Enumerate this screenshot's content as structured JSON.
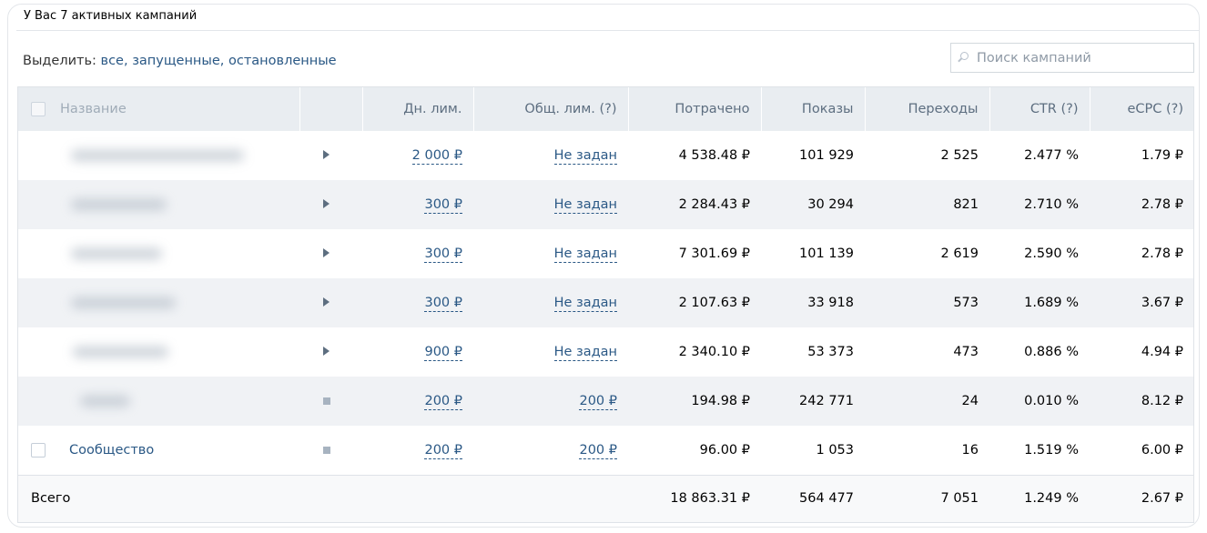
{
  "heading": "У Вас 7 активных кампаний",
  "filter": {
    "label": "Выделить:",
    "all": "все",
    "running": "запущенные",
    "stopped": "остановленные",
    "sep": ","
  },
  "search": {
    "placeholder": "Поиск кампаний"
  },
  "columns": {
    "name": "Название",
    "day_limit": "Дн. лим.",
    "total_limit": "Общ. лим. (?)",
    "spent": "Потрачено",
    "impressions": "Показы",
    "clicks": "Переходы",
    "ctr": "CTR (?)",
    "ecpc": "eCPC (?)"
  },
  "rows": [
    {
      "name": "",
      "status": "running",
      "day_limit": "2 000 ₽",
      "total_limit": "Не задан",
      "spent": "4 538.48 ₽",
      "impressions": "101 929",
      "clicks": "2 525",
      "ctr": "2.477 %",
      "ecpc": "1.79 ₽"
    },
    {
      "name": "",
      "status": "running",
      "day_limit": "300 ₽",
      "total_limit": "Не задан",
      "spent": "2 284.43 ₽",
      "impressions": "30 294",
      "clicks": "821",
      "ctr": "2.710 %",
      "ecpc": "2.78 ₽"
    },
    {
      "name": "",
      "status": "running",
      "day_limit": "300 ₽",
      "total_limit": "Не задан",
      "spent": "7 301.69 ₽",
      "impressions": "101 139",
      "clicks": "2 619",
      "ctr": "2.590 %",
      "ecpc": "2.78 ₽"
    },
    {
      "name": "",
      "status": "running",
      "day_limit": "300 ₽",
      "total_limit": "Не задан",
      "spent": "2 107.63 ₽",
      "impressions": "33 918",
      "clicks": "573",
      "ctr": "1.689 %",
      "ecpc": "3.67 ₽"
    },
    {
      "name": "",
      "status": "running",
      "day_limit": "900 ₽",
      "total_limit": "Не задан",
      "spent": "2 340.10 ₽",
      "impressions": "53 373",
      "clicks": "473",
      "ctr": "0.886 %",
      "ecpc": "4.94 ₽"
    },
    {
      "name": "",
      "status": "stopped",
      "day_limit": "200 ₽",
      "total_limit": "200 ₽",
      "spent": "194.98 ₽",
      "impressions": "242 771",
      "clicks": "24",
      "ctr": "0.010 %",
      "ecpc": "8.12 ₽"
    },
    {
      "name": "Сообщество",
      "status": "stopped",
      "day_limit": "200 ₽",
      "total_limit": "200 ₽",
      "spent": "96.00 ₽",
      "impressions": "1 053",
      "clicks": "16",
      "ctr": "1.519 %",
      "ecpc": "6.00 ₽"
    }
  ],
  "totals": {
    "label": "Всего",
    "spent": "18 863.31 ₽",
    "impressions": "564 477",
    "clicks": "7 051",
    "ctr": "1.249 %",
    "ecpc": "2.67 ₽"
  },
  "colors": {
    "link": "#2a5885",
    "header_bg": "#e9edf1",
    "alt_row_bg": "#f0f2f5",
    "header_text": "#5d6e80"
  },
  "icons": {
    "running": "play-icon",
    "stopped": "stop-icon",
    "search": "search-icon"
  }
}
